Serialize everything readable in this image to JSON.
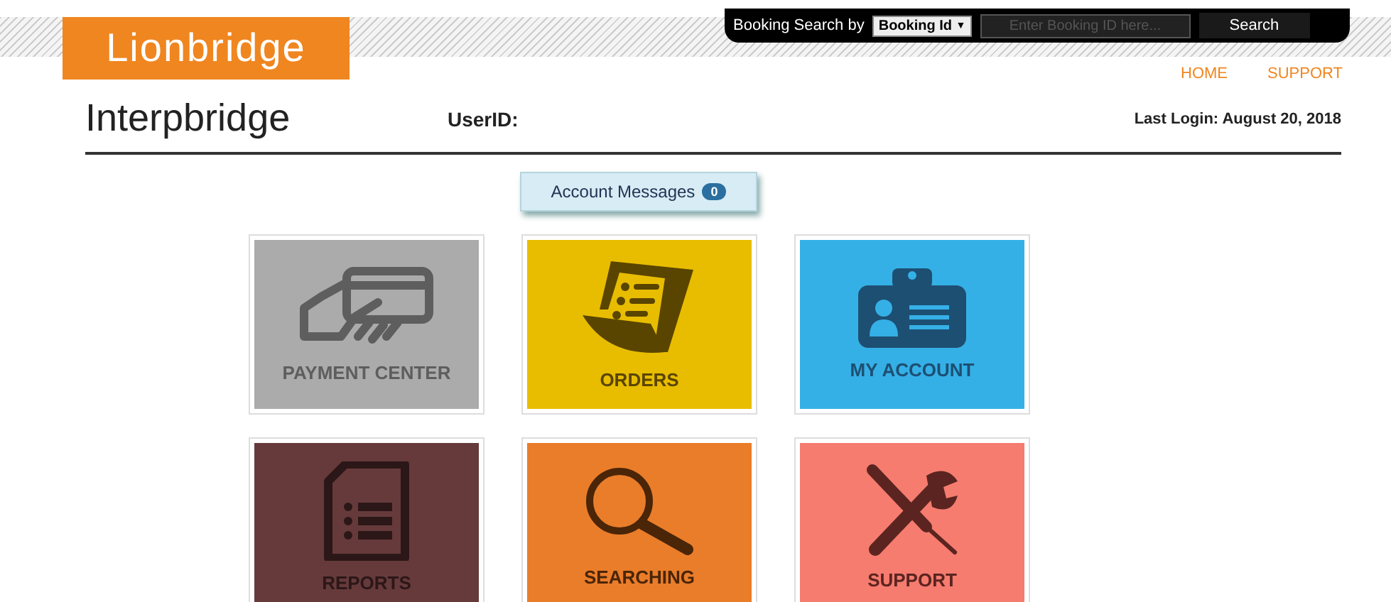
{
  "logo": "Lionbridge",
  "booking_search": {
    "label": "Booking Search by",
    "select": "Booking Id",
    "select_caret": "▼",
    "placeholder": "Enter Booking ID here...",
    "button": "Search"
  },
  "nav": [
    "HOME",
    "SUPPORT"
  ],
  "header": {
    "title": "Interpbridge",
    "user_label": "UserID:",
    "last_login": "Last Login: August 20, 2018"
  },
  "account_messages": {
    "label": "Account Messages",
    "count": "0"
  },
  "tiles": [
    {
      "kind": "payment",
      "label": "PAYMENT CENTER",
      "color": "#ababab"
    },
    {
      "kind": "orders",
      "label": "ORDERS",
      "color": "#e8bd00"
    },
    {
      "kind": "account",
      "label": "MY ACCOUNT",
      "color": "#35b0e6"
    },
    {
      "kind": "reports",
      "label": "REPORTS",
      "color": "#663a3b"
    },
    {
      "kind": "searching",
      "label": "SEARCHING",
      "color": "#ea7d2a"
    },
    {
      "kind": "support",
      "label": "SUPPORT",
      "color": "#f57c6f"
    }
  ]
}
